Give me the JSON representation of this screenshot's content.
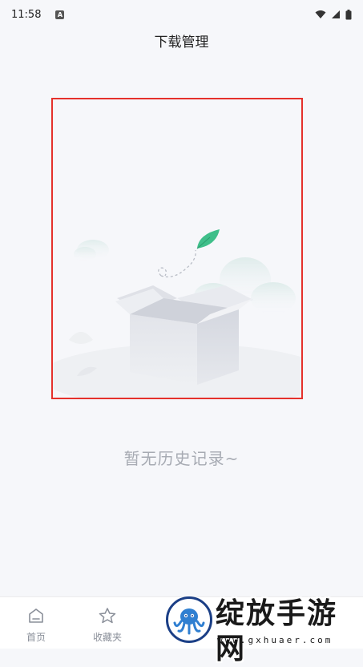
{
  "status_bar": {
    "time": "11:58",
    "notification_badge": "A",
    "icons": [
      "wifi-icon",
      "signal-icon",
      "battery-icon"
    ]
  },
  "header": {
    "title": "下载管理"
  },
  "empty_state": {
    "message": "暂无历史记录~",
    "illustration": "empty-box-illustration"
  },
  "tab_bar": {
    "tabs": [
      {
        "label": "首页",
        "icon": "home-icon"
      },
      {
        "label": "收藏夹",
        "icon": "star-icon"
      }
    ]
  },
  "watermark": {
    "title": "绽放手游网",
    "url": "www.gxhuaer.com"
  },
  "colors": {
    "background": "#f6f7fa",
    "highlight_border": "#e5312b",
    "leaf_green": "#3fbf8a",
    "empty_text": "#a7abb3",
    "watermark_blue": "#1b3f86"
  }
}
